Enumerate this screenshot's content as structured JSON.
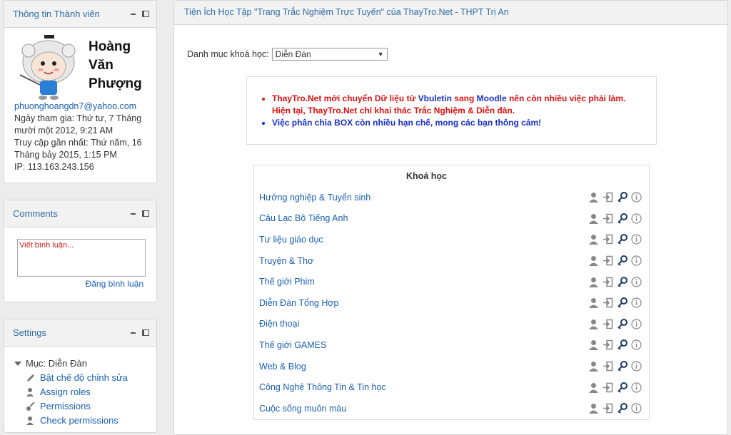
{
  "profile": {
    "title": "Thông tin Thành viên",
    "name_line1": "Hoàng",
    "name_line2": "Văn",
    "name_line3": "Phượng",
    "email": "phuonghoangdn7@yahoo.com",
    "joined": "Ngày tham gia: Thứ tư, 7 Tháng mười một 2012, 9:21 AM",
    "last_access": "Truy cập gần nhất: Thứ năm, 16 Tháng bảy 2015, 1:15 PM",
    "ip": "IP: 113.163.243.156"
  },
  "comments": {
    "title": "Comments",
    "placeholder": "Viết bình luận...",
    "submit_label": "Đăng bình luận"
  },
  "settings": {
    "title": "Settings",
    "section": "Mục: Diễn Đàn",
    "items": [
      {
        "label": "Bật chế độ chỉnh sửa",
        "icon": "pencil-icon"
      },
      {
        "label": "Assign roles",
        "icon": "user-add-icon"
      },
      {
        "label": "Permissions",
        "icon": "key-icon"
      },
      {
        "label": "Check permissions",
        "icon": "user-check-icon"
      }
    ]
  },
  "main": {
    "header": "Tiện Ích Học Tập \"Trang Trắc Nghiệm Trực Tuyến\" của ThayTro.Net - THPT Trị An",
    "category_label": "Danh mục khoá học:",
    "category_value": "Diễn Đàn",
    "notice": {
      "l1_a": "ThayTro.Net mới chuyển Dữ liệu từ ",
      "l1_b": "Vbuletin",
      "l1_c": " sang ",
      "l1_d": "Moodle",
      "l1_e": " nên còn nhiều việc phải làm. Hiện tại, ThayTro.Net chỉ khai thác Trắc Nghiệm & Diễn đàn.",
      "l2": "Việc phân chia BOX còn nhiều hạn chế, mong các bạn thông cảm!"
    },
    "courses_header": "Khoá học",
    "courses": [
      "Hướng nghiệp & Tuyển sinh",
      "Câu Lạc Bộ Tiếng Anh",
      "Tư liệu giáo dục",
      "Truyện & Thơ",
      "Thế giới Phim",
      "Diễn Đàn Tổng Hợp",
      "Điện thoại",
      "Thế giới GAMES",
      "Web & Blog",
      "Công Nghệ Thông Tin & Tin học",
      "Cuộc sống muôn màu"
    ]
  },
  "colors": {
    "link": "#1a5fb4",
    "notice_red": "#e01010",
    "notice_blue": "#1a2fcc",
    "block_title": "#2f6da6"
  }
}
